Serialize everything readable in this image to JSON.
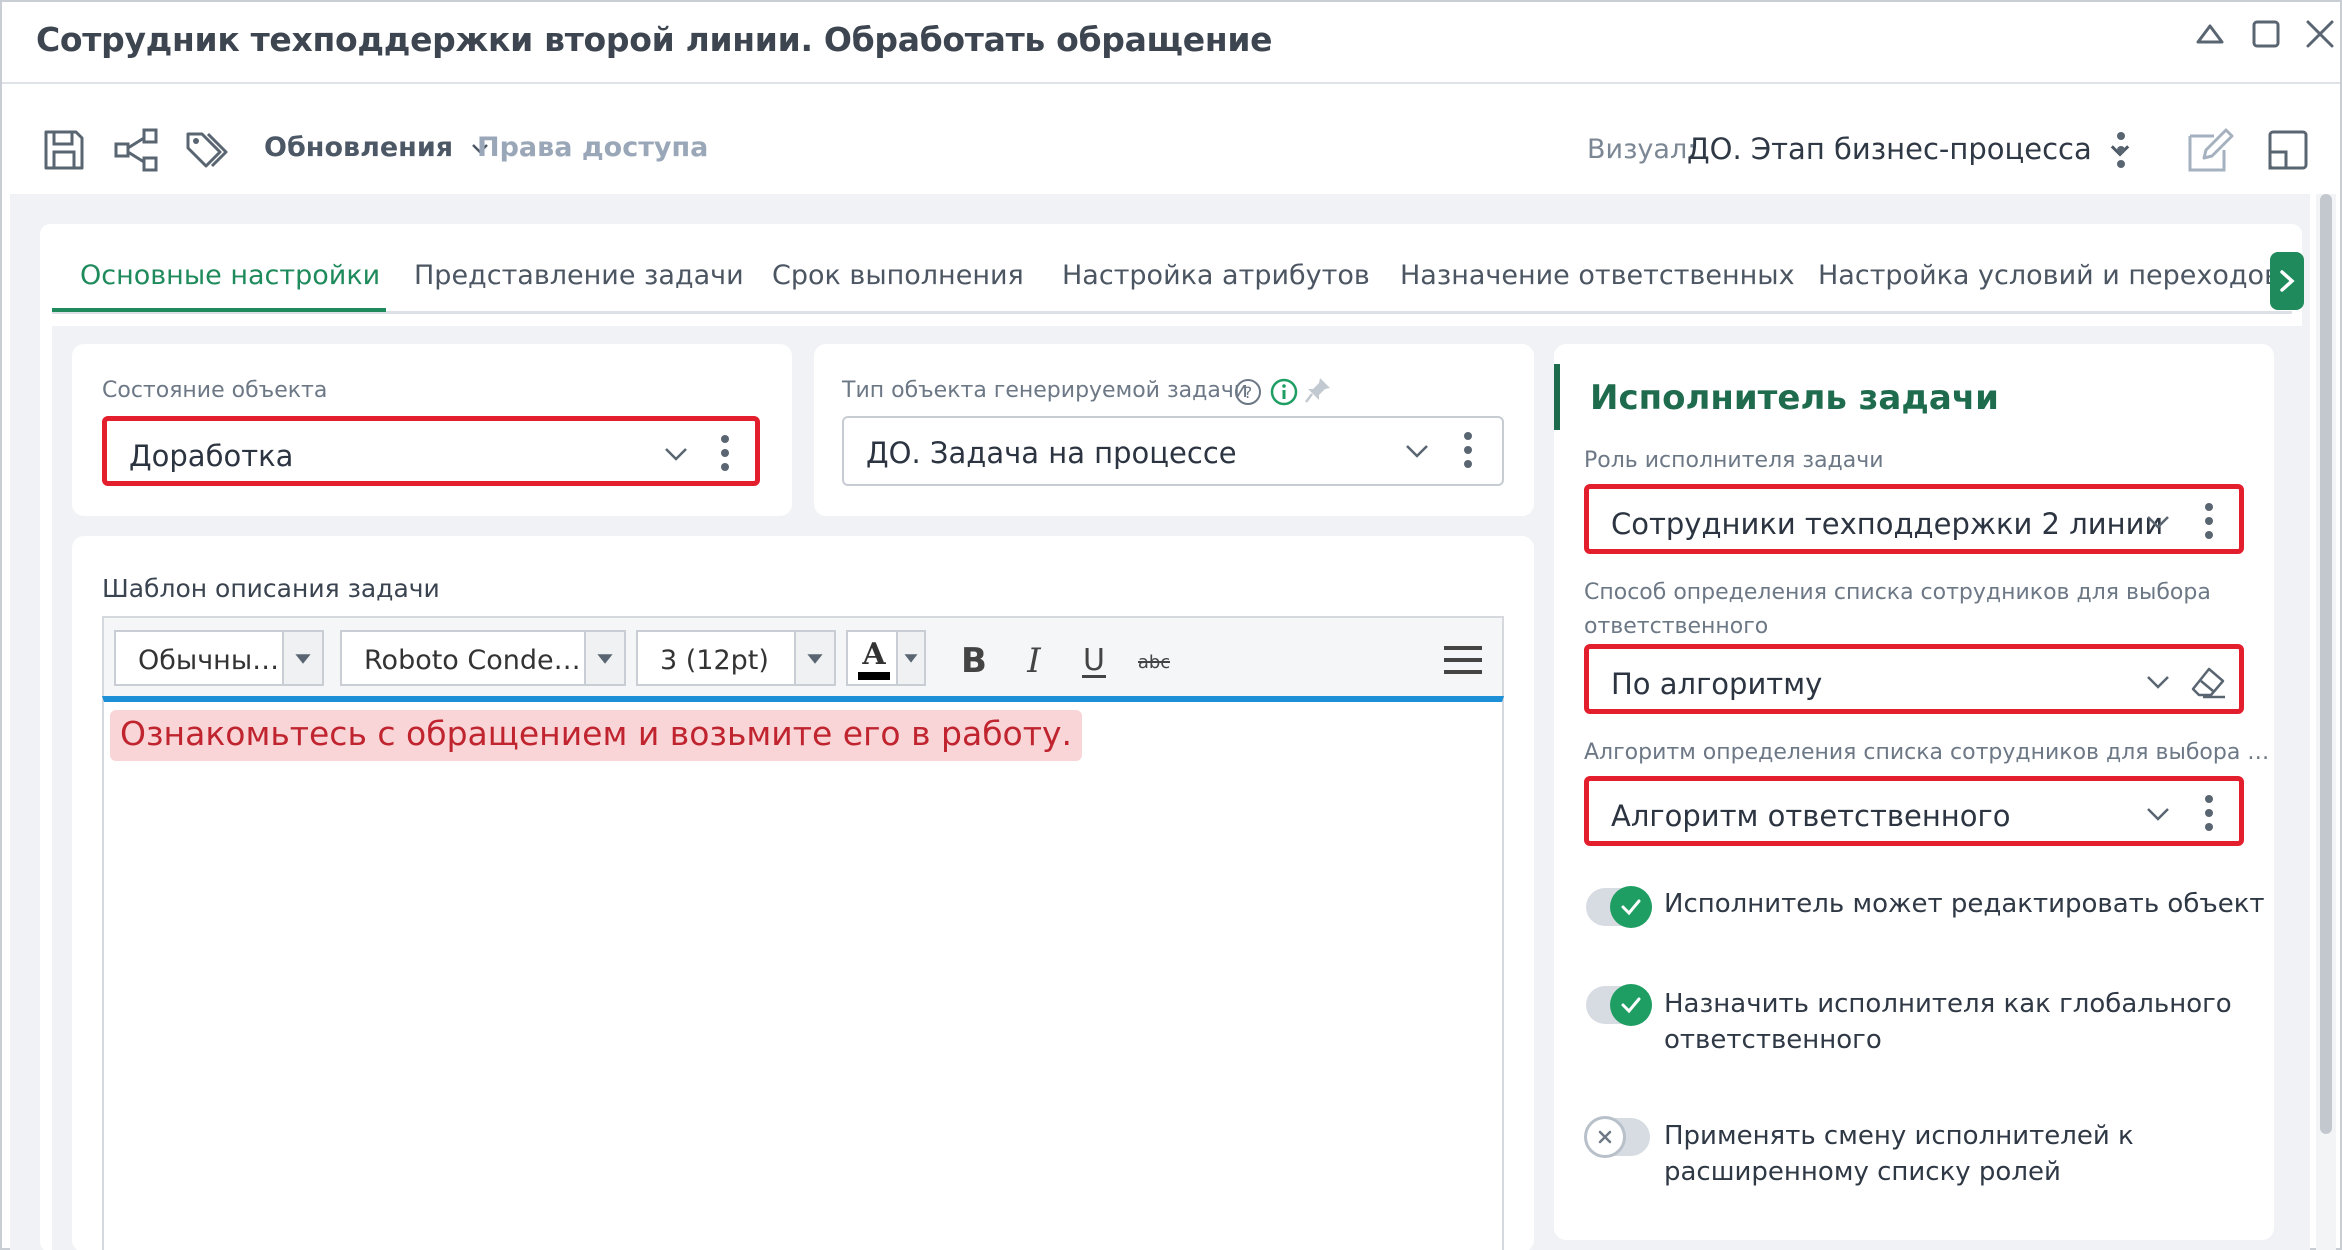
{
  "window": {
    "title": "Сотрудник техподдержки второй линии. Обработать обращение"
  },
  "toolbar": {
    "save_icon": "save-icon",
    "share_icon": "share-icon",
    "tags_icon": "tags-icon",
    "updates_label": "Обновления",
    "access_label": "Права доступа",
    "visual_label": "Визуал:",
    "visual_value": "ДО. Этап бизнес-процесса"
  },
  "tabs": [
    {
      "label": "Основные настройки",
      "active": true
    },
    {
      "label": "Представление задачи"
    },
    {
      "label": "Срок выполнения"
    },
    {
      "label": "Настройка атрибутов"
    },
    {
      "label": "Назначение ответственных"
    },
    {
      "label": "Настройка условий и переходов"
    }
  ],
  "object_state": {
    "label": "Состояние объекта",
    "value": "Доработка"
  },
  "task_type": {
    "label": "Тип объекта генерируемой задачи",
    "value": "ДО. Задача на процессе"
  },
  "template": {
    "label": "Шаблон описания задачи",
    "style_value": "Обычны…",
    "font_value": "Roboto Conde…",
    "size_value": "3 (12pt)",
    "text": "Ознакомьтесь с обращением и возьмите его в работу."
  },
  "executor": {
    "title": "Исполнитель задачи",
    "role_label": "Роль исполнителя задачи",
    "role_value": "Сотрудники техподдержки 2 линии",
    "method_label_line1": "Способ определения списка сотрудников для выбора",
    "method_label_line2": "ответственного",
    "method_value": "По алгоритму",
    "algo_label": "Алгоритм определения списка сотрудников для выбора …",
    "algo_value": "Алгоритм ответственного",
    "toggles": [
      {
        "line1": "Исполнитель может редактировать объект",
        "line2": "",
        "on": true
      },
      {
        "line1": "Назначить исполнителя как глобального",
        "line2": "ответственного",
        "on": true
      },
      {
        "line1": "Применять смену исполнителей к",
        "line2": "расширенному списку ролей",
        "on": false
      }
    ]
  },
  "colors": {
    "accent_green": "#1f8a5c",
    "highlight_red": "#e31e2d",
    "editor_blue": "#1d8fd6"
  }
}
